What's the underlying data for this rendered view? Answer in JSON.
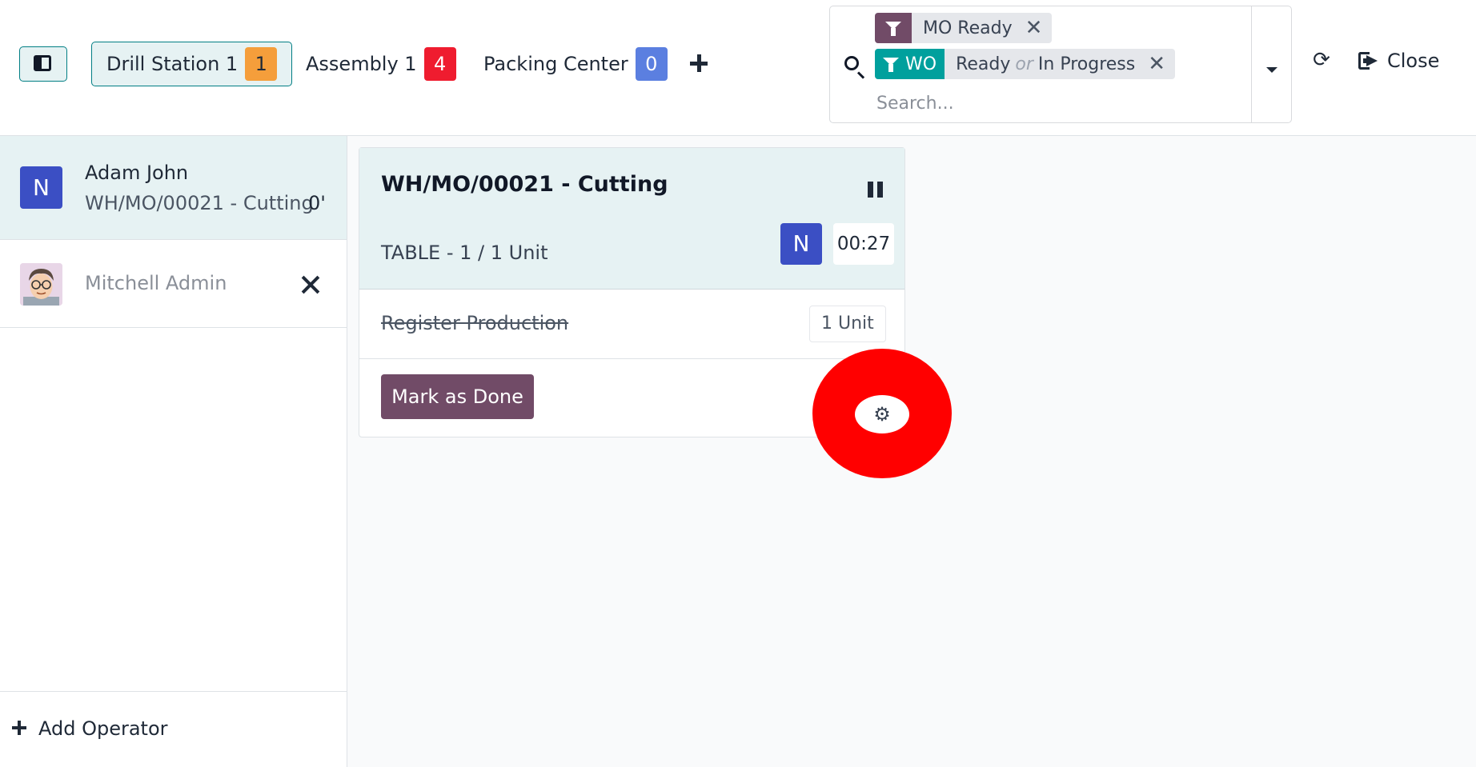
{
  "header": {
    "workcenters": [
      {
        "label": "Drill Station 1",
        "count": "1",
        "color": "#f59e3b"
      },
      {
        "label": "Assembly 1",
        "count": "4",
        "color": "#ef1c2f"
      },
      {
        "label": "Packing Center",
        "count": "0",
        "color": "#5b7fe0"
      }
    ],
    "search": {
      "facets": [
        {
          "tag": "",
          "value": "MO Ready",
          "tag_color": "#714b67"
        },
        {
          "tag": "WO",
          "value_a": "Ready",
          "or": "or",
          "value_b": "In Progress",
          "tag_color": "#00a09d"
        }
      ],
      "placeholder": "Search..."
    },
    "close_label": "Close"
  },
  "operators": {
    "items": [
      {
        "avatar": "N",
        "name": "Adam John",
        "workorder": "WH/MO/00021 - Cutting",
        "time": "0'"
      },
      {
        "name": "Mitchell Admin"
      }
    ],
    "add_label": "Add Operator"
  },
  "workorder": {
    "title": "WH/MO/00021 - Cutting",
    "product": "TABLE - 1 / 1 Unit",
    "avatar": "N",
    "timer": "00:27",
    "step": {
      "label": "Register Production",
      "qty": "1 Unit"
    },
    "done_label": "Mark as Done"
  },
  "icons": {
    "refresh": "refresh-icon",
    "gear": "gear-icon",
    "pause": "pause-icon"
  }
}
